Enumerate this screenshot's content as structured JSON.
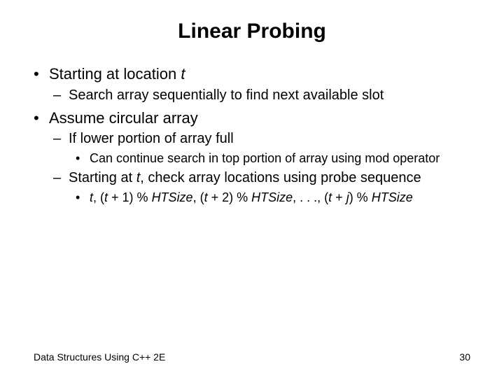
{
  "title": "Linear Probing",
  "b1": {
    "pre": "Starting at location ",
    "it": "t"
  },
  "b1s1": "Search array sequentially to find next available slot",
  "b2": "Assume circular array",
  "b2s1": "If lower portion of array full",
  "b2s1a": "Can continue search in top portion of array using mod operator",
  "b2s2": {
    "pre": "Starting at ",
    "it": "t",
    "post": ", check array locations using probe sequence"
  },
  "b2s2a": {
    "p0": "t",
    "p1": ", (",
    "p2": "t",
    "p3": " + 1) % ",
    "p4": "HTSize",
    "p5": ", (",
    "p6": "t",
    "p7": " + 2) % ",
    "p8": "HTSize",
    "p9": ", . . ., (",
    "p10": "t",
    "p11": " + ",
    "p12": "j",
    "p13": ") % ",
    "p14": "HTSize"
  },
  "footer": {
    "left": "Data Structures Using C++ 2E",
    "right": "30"
  },
  "bullets": {
    "disc": "•",
    "dash": "–"
  }
}
